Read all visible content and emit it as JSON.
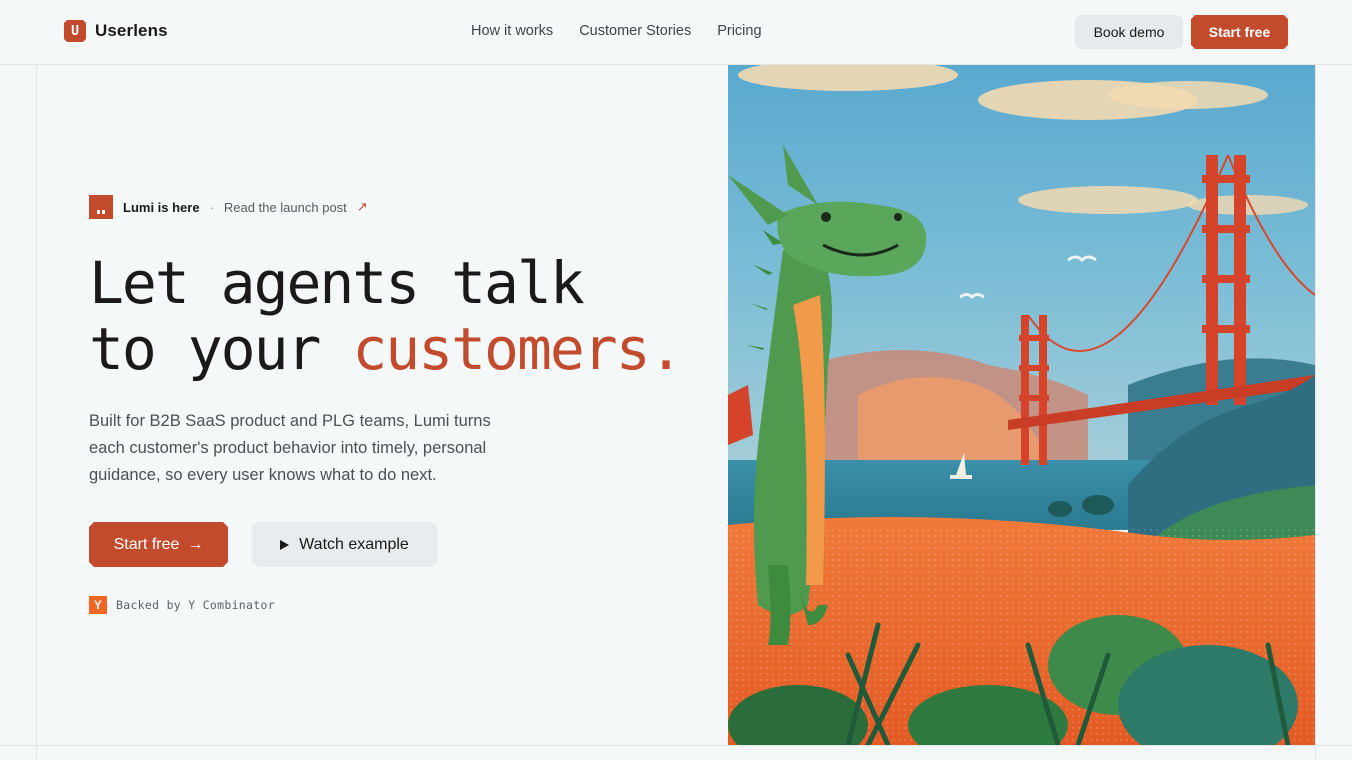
{
  "brand": {
    "name": "Userlens",
    "logo_letter": "U"
  },
  "nav": {
    "links": [
      "How it works",
      "Customer Stories",
      "Pricing"
    ]
  },
  "header_actions": {
    "book_demo": "Book demo",
    "start_free": "Start free"
  },
  "announcement": {
    "label": "Lumi is here",
    "separator": "·",
    "link_text": "Read the launch post",
    "arrow": "↗"
  },
  "hero": {
    "headline_line1": "Let agents talk",
    "headline_line2_prefix": "to your ",
    "headline_accent": "customers.",
    "description": "Built for B2B SaaS product and PLG teams, Lumi turns each customer's product behavior into timely, personal guidance, so every user knows what to do next.",
    "primary_cta": "Start free",
    "primary_cta_arrow": "→",
    "secondary_cta": "Watch example"
  },
  "backed_by": {
    "icon_letter": "Y",
    "text": "Backed by Y Combinator"
  },
  "colors": {
    "accent": "#c14b2c",
    "yc": "#f26522",
    "background": "#f5f8f9"
  }
}
